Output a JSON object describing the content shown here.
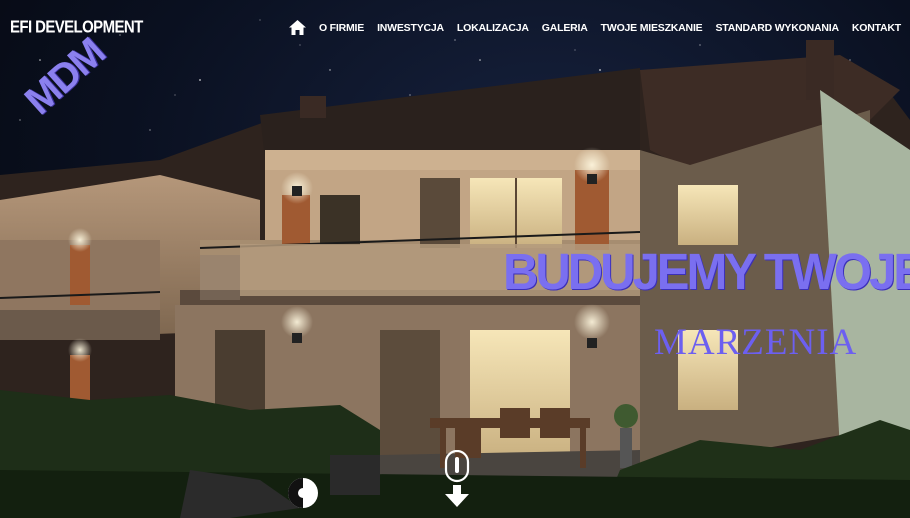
{
  "header": {
    "brand": "EFI DEVELOPMENT",
    "nav": [
      {
        "label": "O FIRMIE"
      },
      {
        "label": "INWESTYCJA"
      },
      {
        "label": "LOKALIZACJA"
      },
      {
        "label": "GALERIA"
      },
      {
        "label": "TWOJE MIESZKANIE"
      },
      {
        "label": "STANDARD WYKONANIA"
      },
      {
        "label": "KONTAKT"
      }
    ],
    "home_icon": "home-icon"
  },
  "hero": {
    "badge": "MDM",
    "headline": "BUDUJEMY TWOJE",
    "subheadline": "MARZENIA",
    "scroll_icon": "mouse-scroll-down-icon"
  },
  "colors": {
    "accent": "#7a6ff0",
    "sky": "#0a1020",
    "wall": "#c9ab87",
    "roof": "#3a2a24",
    "brick": "#a05a32"
  }
}
